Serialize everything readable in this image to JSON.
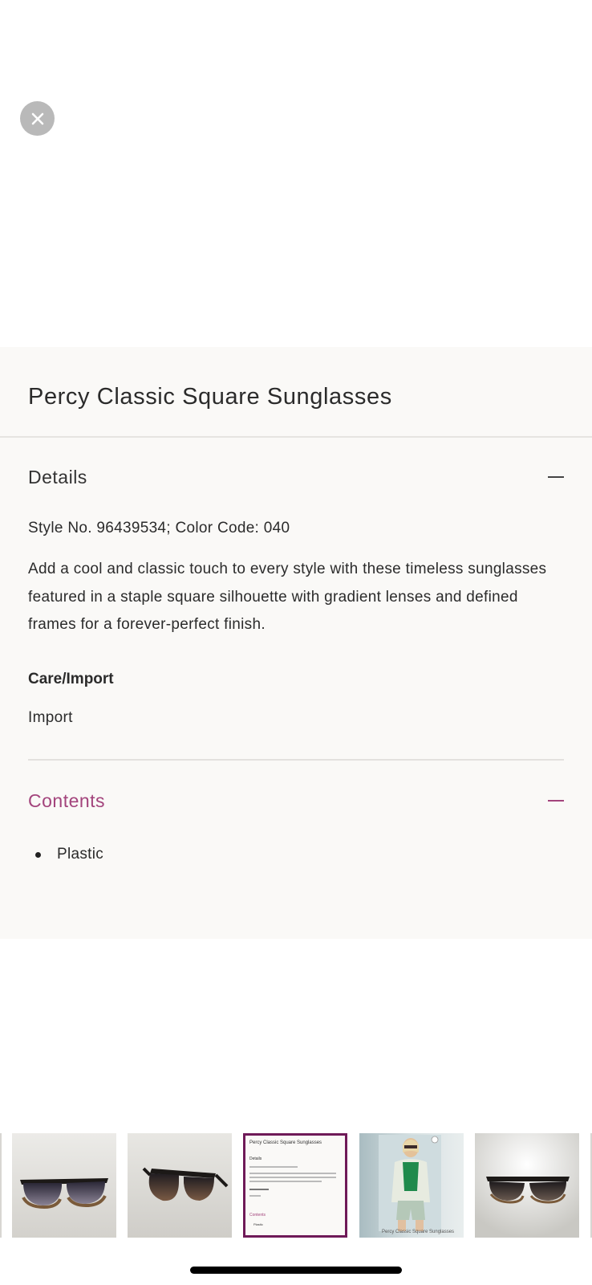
{
  "product": {
    "title": "Percy Classic Square Sunglasses",
    "details": {
      "heading": "Details",
      "style_line": "Style No. 96439534; Color Code: 040",
      "description": "Add a cool and classic touch to every style with these timeless sunglasses featured in a staple square silhouette with gradient lenses and defined frames for a forever-perfect finish.",
      "care_heading": "Care/Import",
      "care_value": "Import"
    },
    "contents": {
      "heading": "Contents",
      "items": [
        "Plastic"
      ]
    }
  },
  "thumbnails": {
    "selected_index": 2,
    "model_caption": "Percy Classic Square Sunglasses",
    "mini_title": "Percy Classic Square Sunglasses",
    "mini_details": "Details",
    "mini_contents": "Contents",
    "mini_item": "Plastic"
  },
  "colors": {
    "accent": "#a3447c",
    "selected_border": "#6f1a58",
    "panel_bg": "#faf9f7",
    "close_bg": "#b9b9b9"
  },
  "icons": {
    "close": "close-icon",
    "collapse": "minus-icon"
  }
}
